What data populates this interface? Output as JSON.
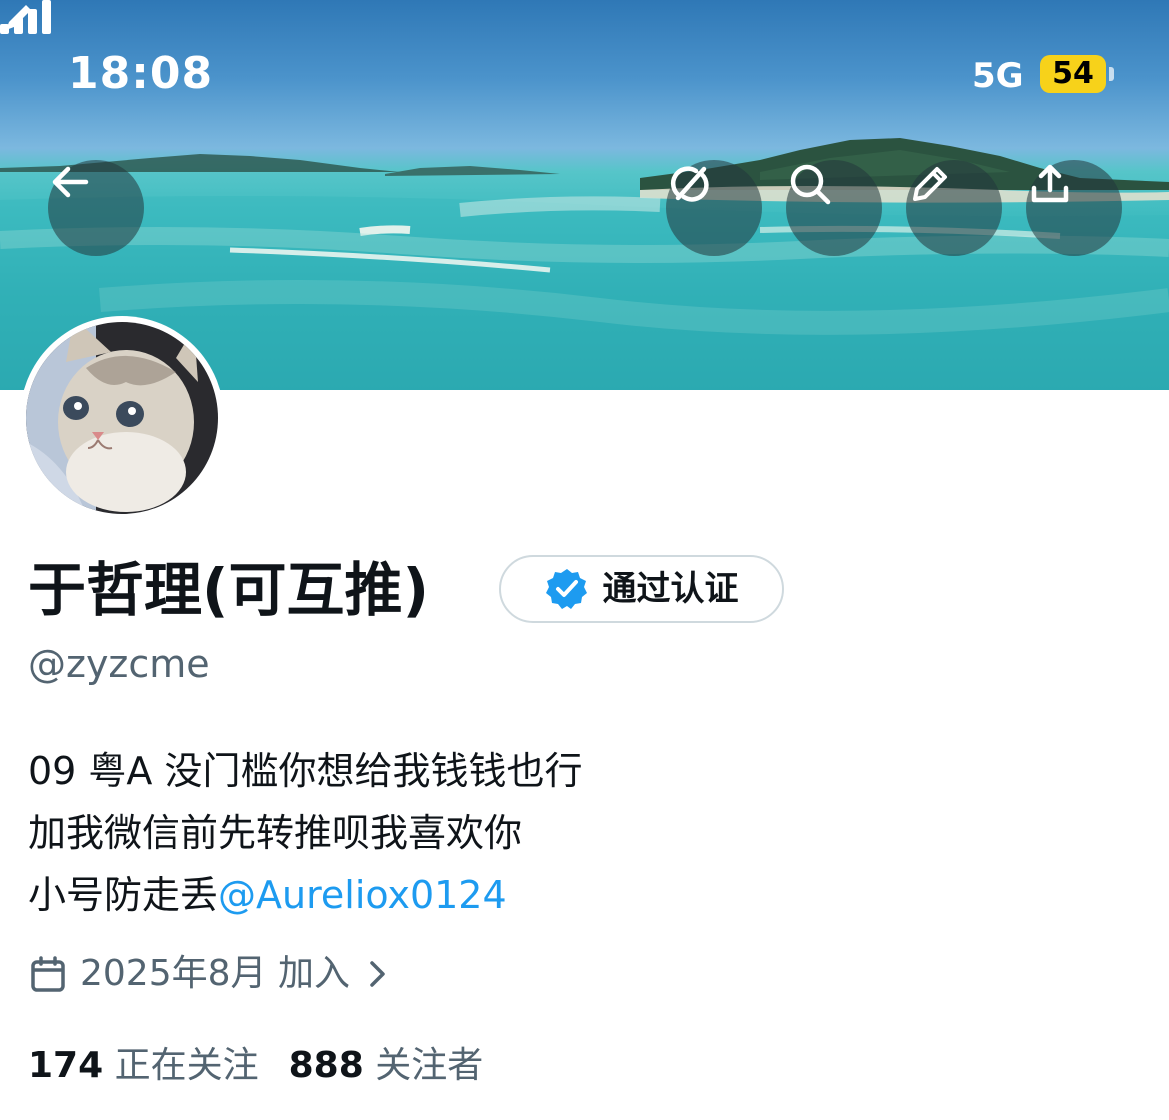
{
  "status_bar": {
    "time": "18:08",
    "network": "5G",
    "battery": "54",
    "battery_color": "#f7d21a"
  },
  "banner": {
    "buttons": [
      {
        "name": "back-button",
        "icon": "arrow-left-icon"
      },
      {
        "name": "grok-button",
        "icon": "grok-icon"
      },
      {
        "name": "search-button",
        "icon": "search-icon"
      },
      {
        "name": "edit-button",
        "icon": "pencil-icon"
      },
      {
        "name": "share-button",
        "icon": "share-icon"
      }
    ]
  },
  "profile": {
    "display_name": "于哲理(可互推)",
    "verified_label": "通过认证",
    "verified_color": "#1d9bf0",
    "handle": "@zyzcme",
    "bio_lines": [
      "09 粤A 没门槛你想给我钱钱也行",
      "加我微信前先转推呗我喜欢你",
      "小号防走丢"
    ],
    "bio_mention": "@Aureliox0124",
    "joined": "2025年8月 加入",
    "following_count": "174",
    "following_label": "正在关注",
    "followers_count": "888",
    "followers_label": "关注者"
  }
}
